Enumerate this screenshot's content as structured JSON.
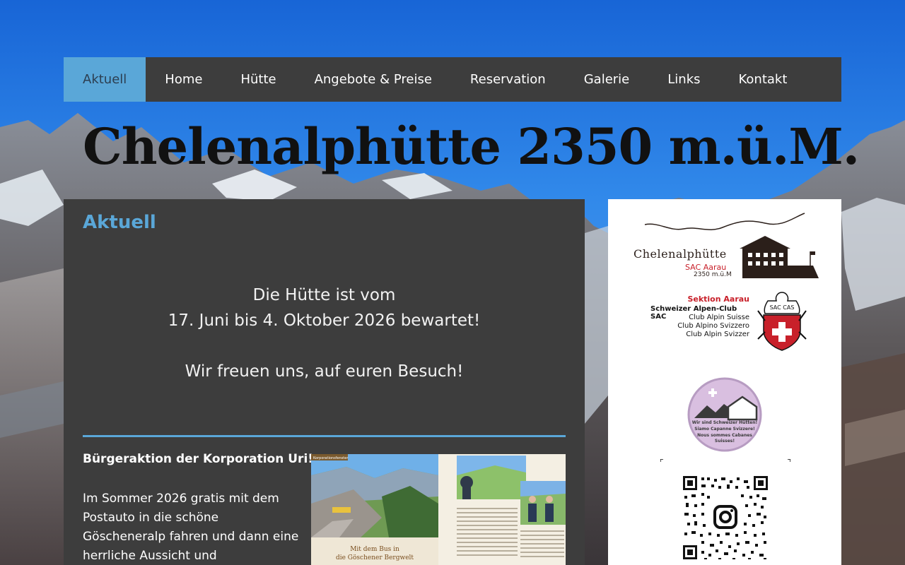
{
  "nav": {
    "items": [
      {
        "label": "Aktuell",
        "active": true
      },
      {
        "label": "Home",
        "active": false
      },
      {
        "label": "Hütte",
        "active": false
      },
      {
        "label": "Angebote & Preise",
        "active": false
      },
      {
        "label": "Reservation",
        "active": false
      },
      {
        "label": "Galerie",
        "active": false
      },
      {
        "label": "Links",
        "active": false
      },
      {
        "label": "Kontakt",
        "active": false
      }
    ]
  },
  "site_title": "Chelenalphütte 2350 m.ü.M.",
  "main": {
    "heading": "Aktuell",
    "announce_line1": "Die Hütte ist vom",
    "announce_line2": "17. Juni bis 4. Oktober 2026 bewartet!",
    "announce_line3": "Wir freuen uns, auf euren Besuch!",
    "promo_title": "Bürgeraktion der Korporation Uri!",
    "promo_text_lines": [
      "Im Sommer 2026 gratis mit dem",
      "Postauto in die schöne",
      "Göscheneralp fahren und dann eine",
      "herrliche Aussicht und"
    ],
    "promo_image_caption_1": "Mit dem Bus in",
    "promo_image_caption_2": "die Göschener Bergwelt",
    "promo_image_tag": "Korporationsfenster"
  },
  "sidebar": {
    "logo_name": "Chelenalphütte",
    "logo_section": "SAC Aarau",
    "logo_altitude": "2350 m.ü.M",
    "sac_section": "Sektion Aarau",
    "sac_lines": [
      "Schweizer Alpen-Club SAC",
      "Club Alpin Suisse",
      "Club Alpino Svizzero",
      "Club Alpin Svizzer"
    ],
    "sac_crest_text": "SAC CAS",
    "badge_lines": [
      "Wir sind Schweizer Hütten!",
      "Siamo Capanne Svizzere!",
      "Nous sommes Cabanes",
      "Suisses!"
    ],
    "qr_icon": "instagram-icon"
  },
  "colors": {
    "accent": "#5aa7d8",
    "panel": "#3d3d3d",
    "sac_red": "#c8202a"
  }
}
